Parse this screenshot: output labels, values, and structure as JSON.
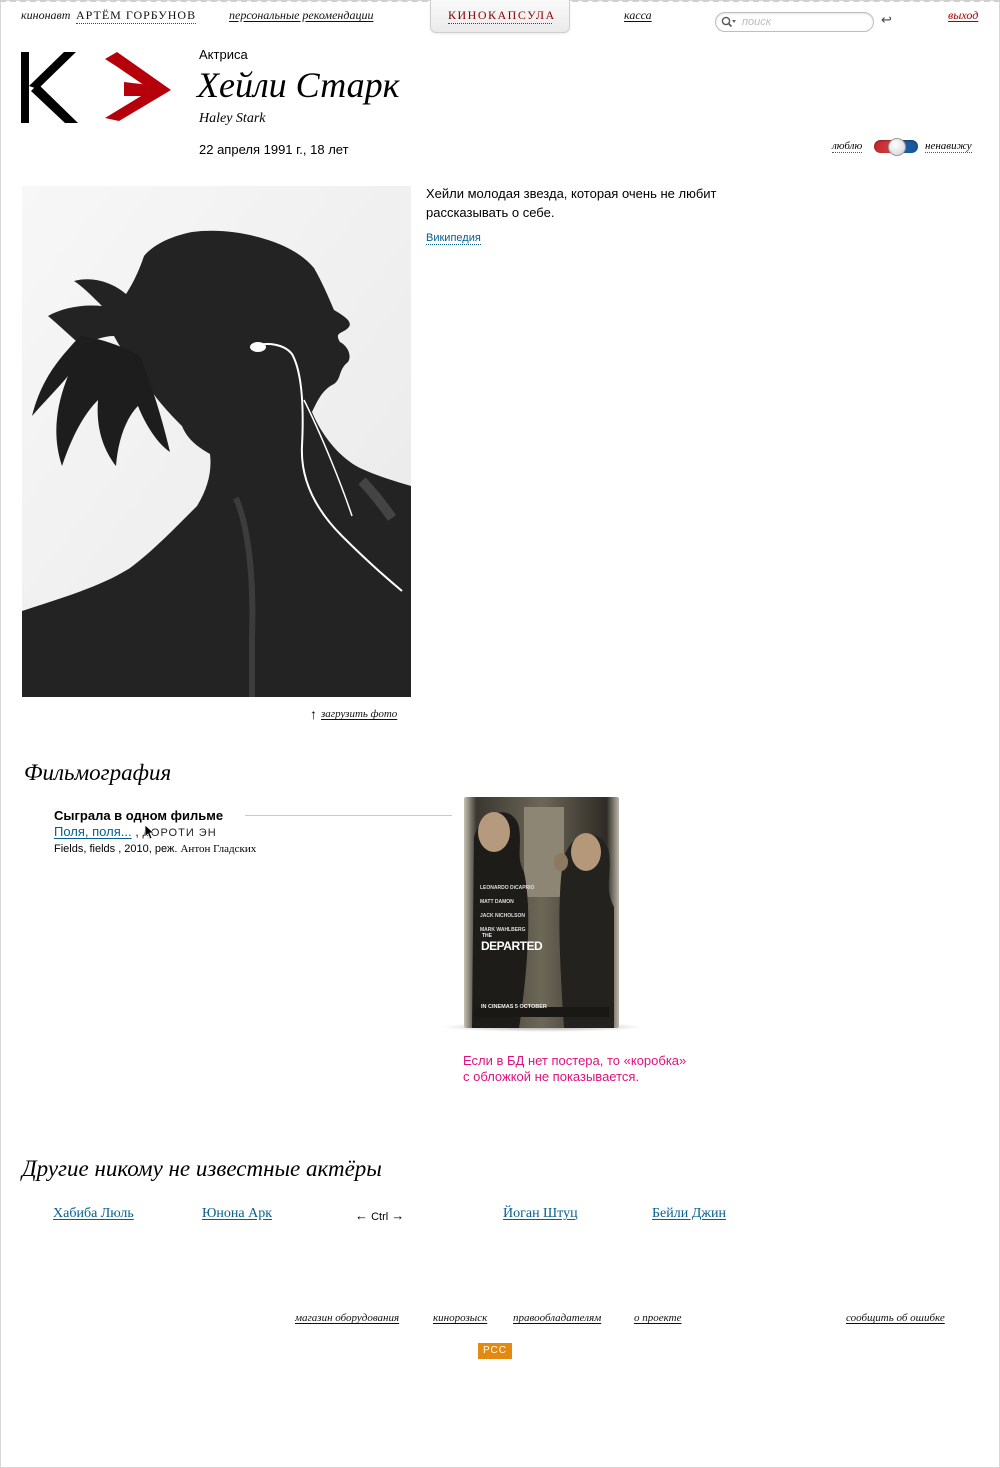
{
  "header": {
    "user_prefix": "кинонавт",
    "user_name": "АРТЁМ ГОРБУНОВ",
    "recommendations": "персональные рекомендации",
    "active_tab": "КИНОКАПСУЛА",
    "box_office": "касса",
    "search_placeholder": "поиск",
    "search_submit": "↩",
    "logout": "выход"
  },
  "person": {
    "role": "Актриса",
    "name": "Хейли Старк",
    "name_en": "Haley Stark",
    "birth": "22 апреля 1991 г., 18 лет",
    "bio": [
      "Хейли молодая звезда, которая очень не любит",
      "рассказывать о себе."
    ],
    "wikipedia": "Википедия",
    "upload_photo": "загрузить фото"
  },
  "rating": {
    "love": "люблю",
    "hate": "ненавижу",
    "love_color": "#c0282d",
    "hate_color": "#1f64a6"
  },
  "filmography": {
    "title": "Фильмография",
    "count_label": "Сыграла в одном фильме",
    "film": {
      "title_link": "Поля, поля...",
      "role_suffix": "Дороти Эн",
      "meta_prefix": "Fields, fields , 2010, реж.",
      "director": "Антон Гладских"
    },
    "poster_note": [
      "Если в БД нет постера, то «коробка»",
      "с обложкой не показывается."
    ],
    "poster_text": {
      "actors": [
        "LEONARDO DiCAPRIO",
        "MATT DAMON",
        "JACK NICHOLSON",
        "MARK WAHLBERG"
      ],
      "title": "DEPARTED",
      "title_prefix": "THE",
      "date": "IN CINEMAS 5 OCTOBER"
    }
  },
  "others": {
    "title": "Другие никому не известные актёры",
    "actors": [
      "Хабиба Люль",
      "Юнона Арк",
      "Йоган Штуц",
      "Бейли Джин"
    ],
    "nav_left": "←",
    "nav_label": "Ctrl",
    "nav_right": "→"
  },
  "footer": {
    "links": [
      "магазин оборудования",
      "кинорозыск",
      "правообладателям",
      "о проекте"
    ],
    "report": "сообщить об ошибке",
    "rss": "РСС"
  },
  "colors": {
    "link": "#05608f",
    "accent_red": "#8b0000",
    "note_magenta": "#e0117f",
    "rss": "#e38a12"
  }
}
